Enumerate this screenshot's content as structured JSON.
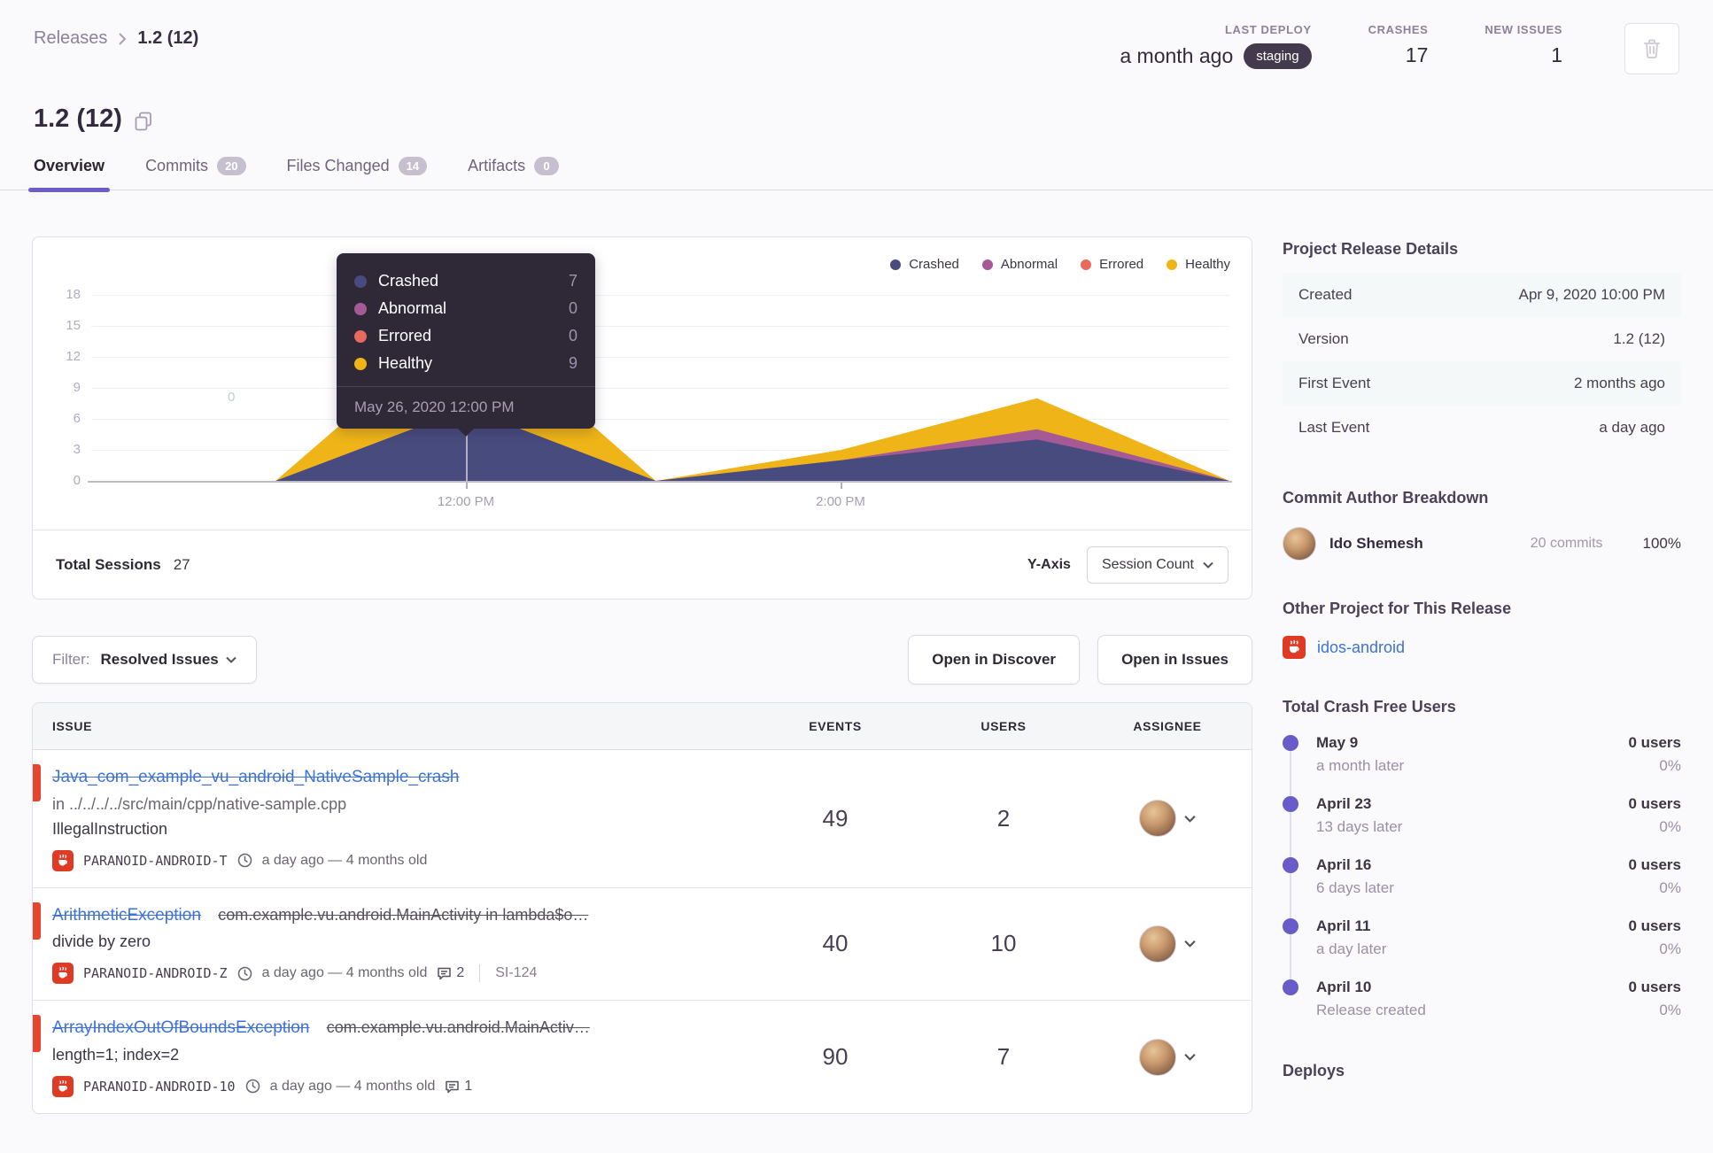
{
  "breadcrumb": {
    "parent": "Releases",
    "current": "1.2 (12)"
  },
  "header_stats": {
    "last_deploy": {
      "label": "LAST DEPLOY",
      "value": "a month ago",
      "env": "staging"
    },
    "crashes": {
      "label": "CRASHES",
      "value": "17"
    },
    "new_issues": {
      "label": "NEW ISSUES",
      "value": "1"
    }
  },
  "page": {
    "title": "1.2 (12)"
  },
  "tabs": [
    {
      "label": "Overview"
    },
    {
      "label": "Commits",
      "badge": "20"
    },
    {
      "label": "Files Changed",
      "badge": "14"
    },
    {
      "label": "Artifacts",
      "badge": "0"
    }
  ],
  "chart": {
    "y_ticks": [
      "18",
      "15",
      "12",
      "9",
      "6",
      "3",
      "0"
    ],
    "x_labels": [
      "12:00 PM",
      "2:00 PM"
    ],
    "watermark": "0",
    "tooltip": {
      "rows": [
        {
          "label": "Crashed",
          "value": "7"
        },
        {
          "label": "Abnormal",
          "value": "0"
        },
        {
          "label": "Errored",
          "value": "0"
        },
        {
          "label": "Healthy",
          "value": "9"
        }
      ],
      "timestamp": "May 26, 2020 12:00 PM"
    },
    "footer": {
      "total_label": "Total Sessions",
      "total_value": "27",
      "yaxis_label": "Y-Axis",
      "yaxis_value": "Session Count"
    }
  },
  "chart_data": {
    "type": "area",
    "stacked": true,
    "title": "Release sessions over time",
    "x": [
      "11:00 AM",
      "12:00 PM",
      "1:00 PM",
      "2:00 PM",
      "3:00 PM",
      "4:00 PM"
    ],
    "x_norm": [
      0.162,
      0.33,
      0.496,
      0.659,
      0.831,
      1.0
    ],
    "series": [
      {
        "name": "Crashed",
        "color": "#474b7d",
        "values": [
          0,
          7,
          0,
          2,
          4,
          0
        ]
      },
      {
        "name": "Abnormal",
        "color": "#a55a95",
        "values": [
          0,
          0,
          0,
          0,
          1,
          0
        ]
      },
      {
        "name": "Errored",
        "color": "#e8695e",
        "values": [
          0,
          0,
          0,
          0,
          0,
          0
        ]
      },
      {
        "name": "Healthy",
        "color": "#efb417",
        "values": [
          0,
          9,
          0,
          1,
          3,
          0
        ]
      }
    ],
    "ylim": [
      0,
      18
    ],
    "y_ticks": [
      0,
      3,
      6,
      9,
      12,
      15,
      18
    ],
    "x_tick_labels": [
      {
        "label": "12:00 PM",
        "norm": 0.33
      },
      {
        "label": "2:00 PM",
        "norm": 0.659
      }
    ],
    "legend_position": "top-right",
    "grid": true,
    "total_sessions": 27
  },
  "filter_bar": {
    "filter_prefix": "Filter:",
    "filter_value": "Resolved Issues",
    "discover_button": "Open in Discover",
    "issues_button": "Open in Issues"
  },
  "issues_table": {
    "columns": [
      "ISSUE",
      "EVENTS",
      "USERS",
      "ASSIGNEE"
    ],
    "rows": [
      {
        "title": "Java_com_example_vu_android_NativeSample_crash",
        "location": "in ../../../../src/main/cpp/native-sample.cpp",
        "message": "IllegalInstruction",
        "project": "PARANOID-ANDROID-T",
        "age": "a day ago — 4 months old",
        "events": "49",
        "users": "2"
      },
      {
        "title": "ArithmeticException",
        "culprit": "com.example.vu.android.MainActivity in lambda$o…",
        "message": "divide by zero",
        "project": "PARANOID-ANDROID-Z",
        "age": "a day ago — 4 months old",
        "comments": "2",
        "ticket": "SI-124",
        "events": "40",
        "users": "10"
      },
      {
        "title": "ArrayIndexOutOfBoundsException",
        "culprit": "com.example.vu.android.MainActiv…",
        "message": "length=1; index=2",
        "project": "PARANOID-ANDROID-10",
        "age": "a day ago — 4 months old",
        "comments": "1",
        "events": "90",
        "users": "7"
      }
    ]
  },
  "sidebar": {
    "details": {
      "heading": "Project Release Details",
      "rows": [
        {
          "label": "Created",
          "value": "Apr 9, 2020 10:00 PM"
        },
        {
          "label": "Version",
          "value": "1.2 (12)"
        },
        {
          "label": "First Event",
          "value": "2 months ago"
        },
        {
          "label": "Last Event",
          "value": "a day ago"
        }
      ]
    },
    "authors": {
      "heading": "Commit Author Breakdown",
      "name": "Ido Shemesh",
      "commits": "20 commits",
      "percent": "100%"
    },
    "other_project": {
      "heading": "Other Project for This Release",
      "project": "idos-android"
    },
    "crash_free": {
      "heading": "Total Crash Free Users",
      "entries": [
        {
          "date": "May 9",
          "when": "a month later",
          "users": "0 users",
          "percent": "0%"
        },
        {
          "date": "April 23",
          "when": "13 days later",
          "users": "0 users",
          "percent": "0%"
        },
        {
          "date": "April 16",
          "when": "6 days later",
          "users": "0 users",
          "percent": "0%"
        },
        {
          "date": "April 11",
          "when": "a day later",
          "users": "0 users",
          "percent": "0%"
        },
        {
          "date": "April 10",
          "when": "Release created",
          "users": "0 users",
          "percent": "0%"
        }
      ]
    },
    "deploys_heading": "Deploys"
  }
}
